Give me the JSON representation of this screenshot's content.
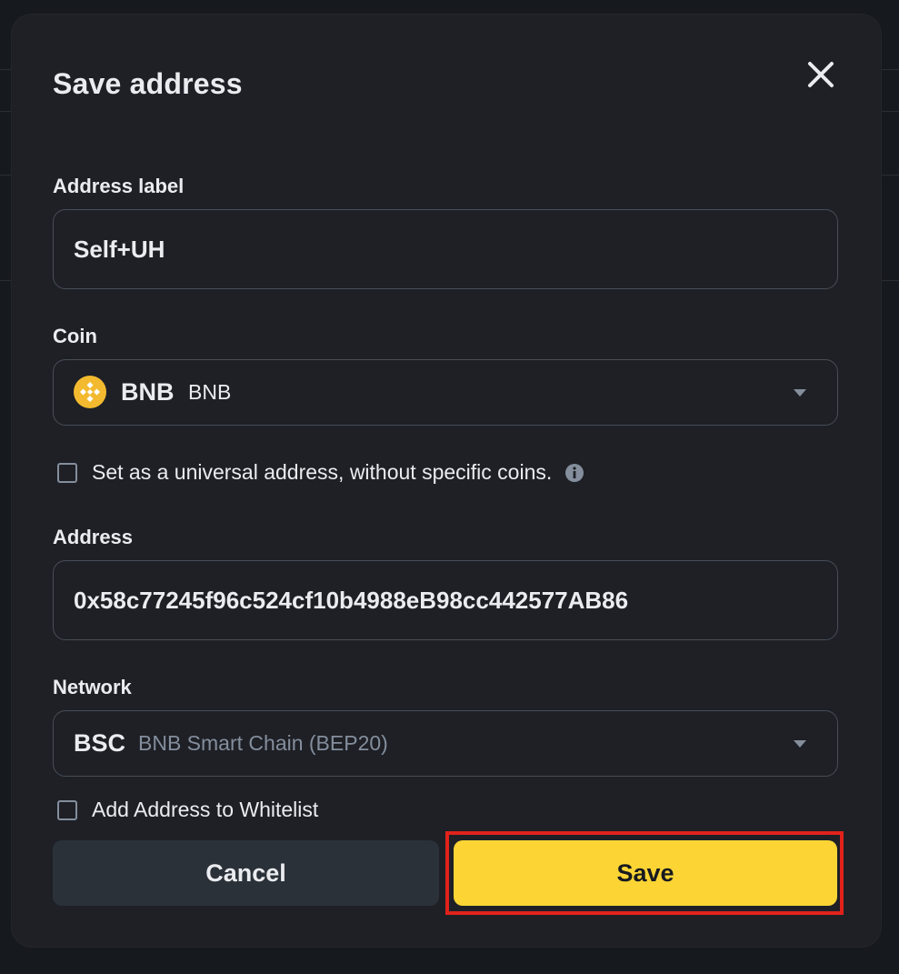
{
  "modal": {
    "title": "Save address"
  },
  "address_label": {
    "label": "Address label",
    "value": "Self+UH"
  },
  "coin": {
    "label": "Coin",
    "symbol": "BNB",
    "name": "BNB",
    "icon": "bnb-coin-icon",
    "icon_color": "#F3BA2F"
  },
  "universal": {
    "text": "Set as a universal address, without specific coins.",
    "checked": false
  },
  "address": {
    "label": "Address",
    "value": "0x58c77245f96c524cf10b4988eB98cc442577AB86"
  },
  "network": {
    "label": "Network",
    "code": "BSC",
    "name": "BNB Smart Chain (BEP20)"
  },
  "whitelist": {
    "text": "Add Address to Whitelist",
    "checked": false
  },
  "buttons": {
    "cancel": "Cancel",
    "save": "Save"
  },
  "colors": {
    "accent": "#FCD535",
    "highlight_border": "#E0221B",
    "background": "#1E2026"
  }
}
